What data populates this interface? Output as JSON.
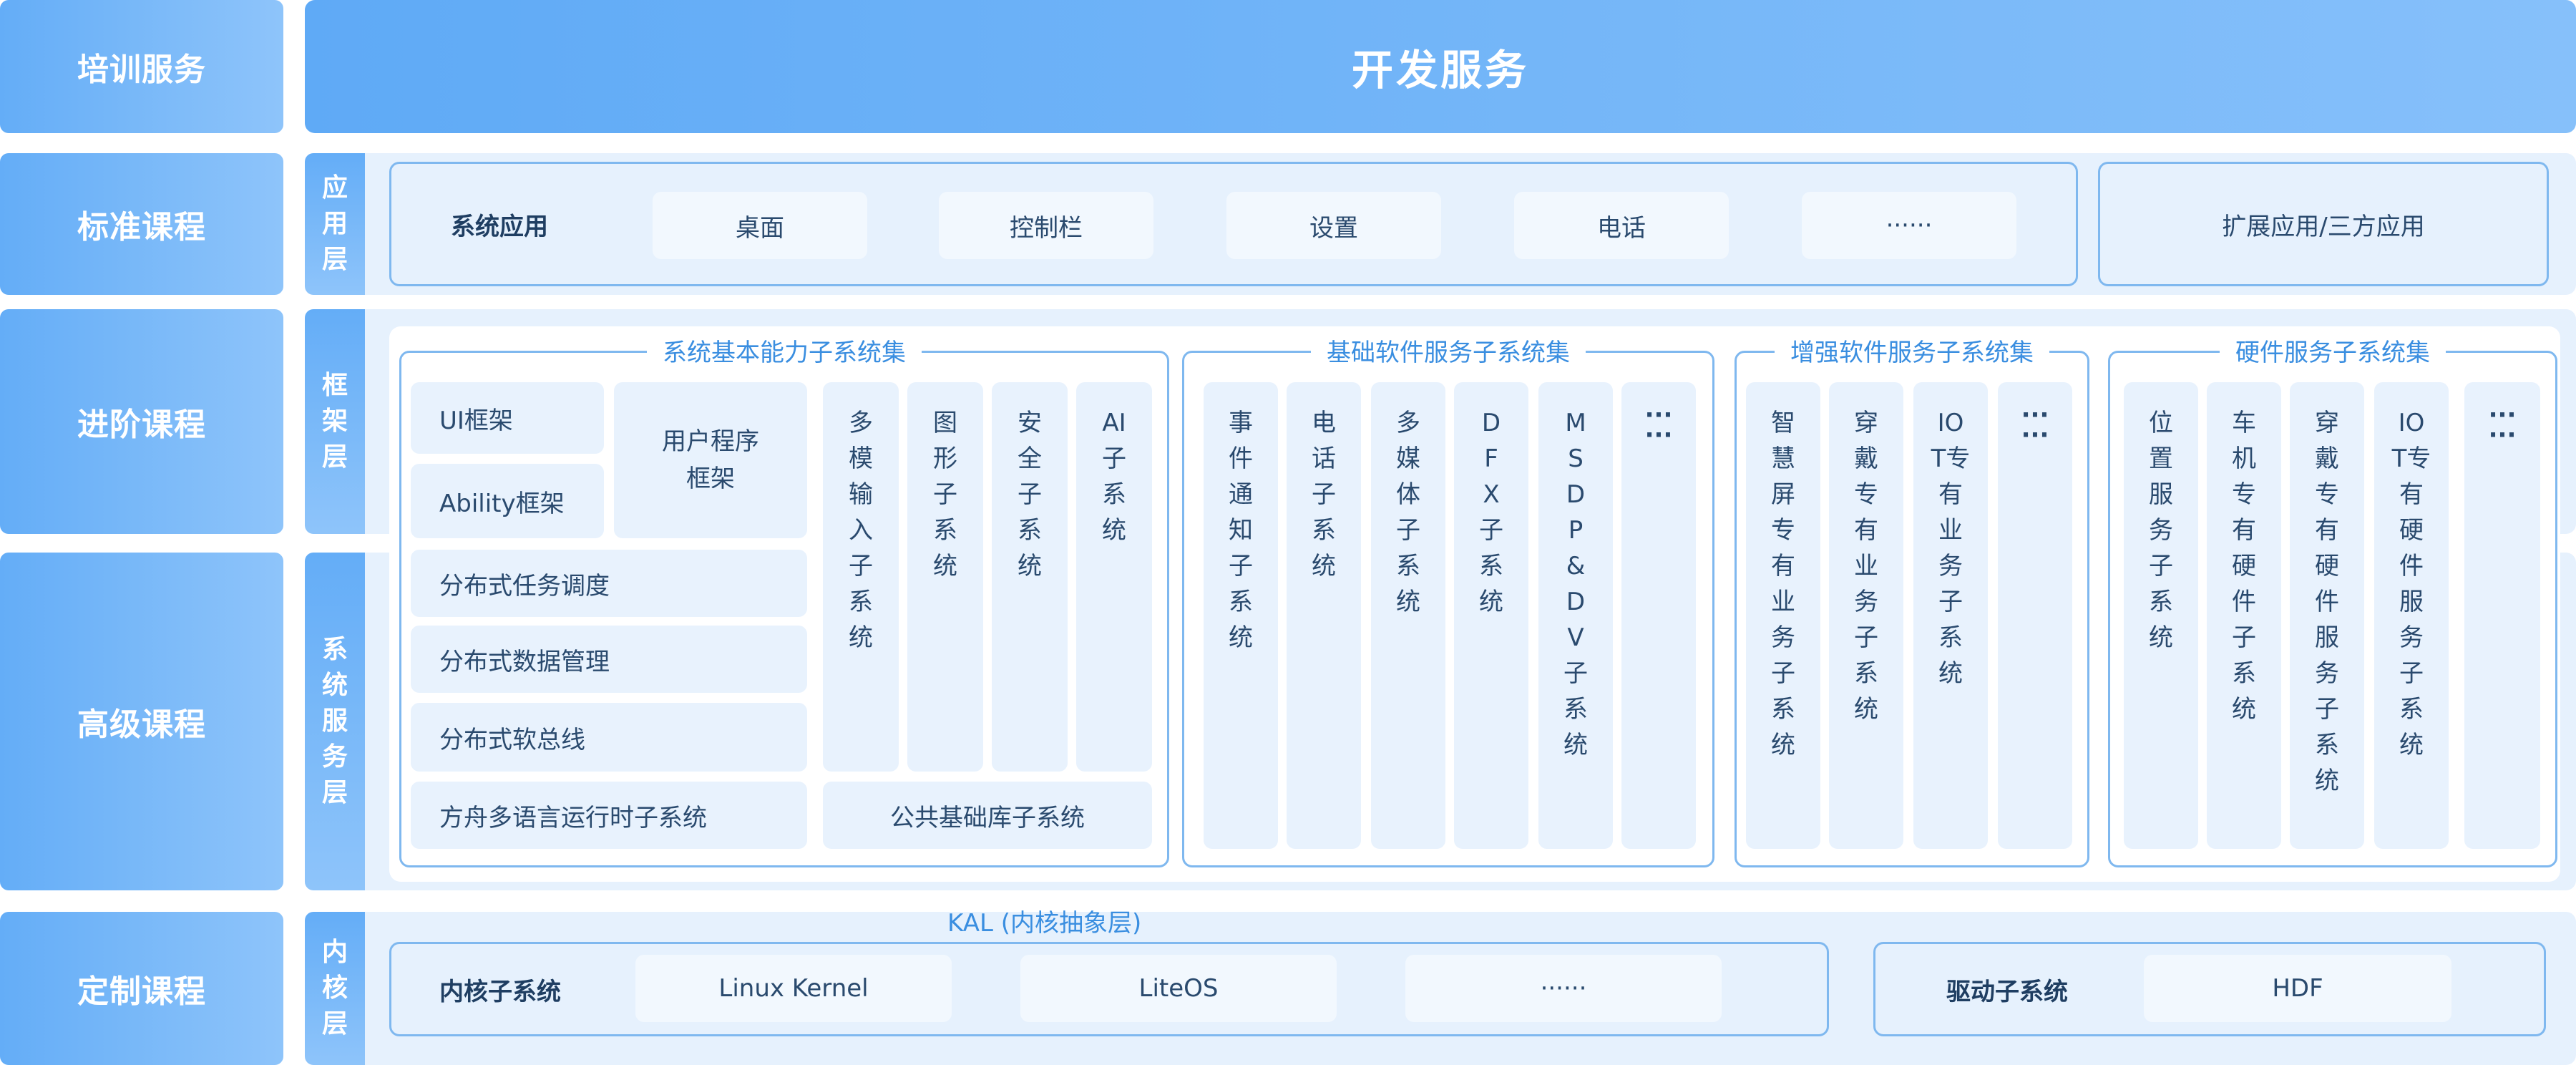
{
  "courses": {
    "training": "培训服务",
    "standard": "标准课程",
    "advanced": "进阶课程",
    "senior": "高级课程",
    "custom": "定制课程"
  },
  "banner": "开发服务",
  "app_layer": {
    "label": "应用层",
    "system_apps_label": "系统应用",
    "items": [
      "桌面",
      "控制栏",
      "设置",
      "电话",
      "······"
    ],
    "extended": "扩展应用/三方应用"
  },
  "framework_layer": {
    "label": "框架层"
  },
  "system_service_layer": {
    "label": "系统服务层"
  },
  "basic_capability": {
    "title": "系统基本能力子系统集",
    "ui_framework": "UI框架",
    "ability_framework": "Ability框架",
    "user_program_framework": "用户程序框架",
    "multimodal_input": "多模输入子系统",
    "graphics": "图形子系统",
    "security": "安全子系统",
    "ai": "AI子系统",
    "distributed_scheduling": "分布式任务调度",
    "distributed_data": "分布式数据管理",
    "distributed_bus": "分布式软总线",
    "ark_runtime": "方舟多语言运行时子系统",
    "common_library": "公共基础库子系统"
  },
  "basic_software": {
    "title": "基础软件服务子系统集",
    "items": [
      "事件通知子系统",
      "电话子系统",
      "多媒体子系统",
      "DFX子系统",
      "MSDP&DV子系统",
      "······"
    ]
  },
  "enhanced_software": {
    "title": "增强软件服务子系统集",
    "items": [
      "智慧屏专有业务子系统",
      "穿戴专有业务子系统",
      "IOT专有业务子系统",
      "······"
    ]
  },
  "hardware_service": {
    "title": "硬件服务子系统集",
    "items": [
      "位置服务子系统",
      "车机专有硬件子系统",
      "穿戴专有硬件服务子系统",
      "IOT专有硬件服务子系统",
      "······"
    ]
  },
  "kernel_layer": {
    "label": "内核层",
    "kal": "KAL (内核抽象层)",
    "kernel_subsystem": "内核子系统",
    "items": [
      "Linux Kernel",
      "LiteOS",
      "······"
    ],
    "driver_subsystem": "驱动子系统",
    "hdf": "HDF"
  },
  "colors": {
    "accent": "#64adf7",
    "band": "#e6f1fd",
    "outline": "#7fb8ef",
    "group_title": "#3a8ee0",
    "text": "#2a4a6e"
  }
}
